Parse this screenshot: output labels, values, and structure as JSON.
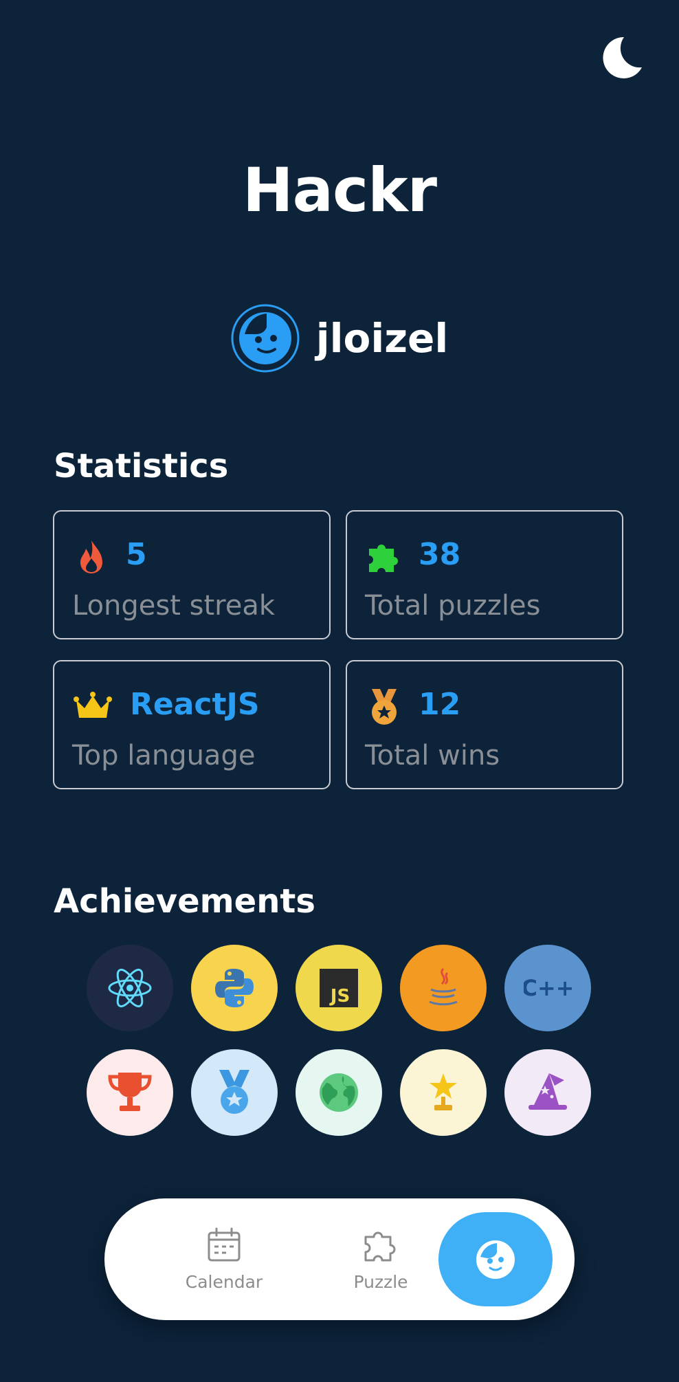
{
  "app": {
    "title": "Hackr"
  },
  "profile": {
    "username": "jloizel"
  },
  "statistics": {
    "title": "Statistics",
    "cards": [
      {
        "icon": "flame-icon",
        "value": "5",
        "label": "Longest streak"
      },
      {
        "icon": "puzzle-piece-icon",
        "value": "38",
        "label": "Total puzzles"
      },
      {
        "icon": "crown-icon",
        "value": "ReactJS",
        "label": "Top language"
      },
      {
        "icon": "medal-icon",
        "value": "12",
        "label": "Total wins"
      }
    ]
  },
  "achievements": {
    "title": "Achievements",
    "badges": [
      {
        "icon": "react-icon",
        "bg": "#1e2a45"
      },
      {
        "icon": "python-icon",
        "bg": "#f7d34e"
      },
      {
        "icon": "javascript-icon",
        "bg": "#efd84c"
      },
      {
        "icon": "java-icon",
        "bg": "#f39a23"
      },
      {
        "icon": "cplusplus-icon",
        "bg": "#5b93cf"
      },
      {
        "icon": "trophy-icon",
        "bg": "#fdeaea"
      },
      {
        "icon": "medal-badge-icon",
        "bg": "#d3e8f8"
      },
      {
        "icon": "globe-icon",
        "bg": "#e6f6f0"
      },
      {
        "icon": "star-award-icon",
        "bg": "#fbf5d6"
      },
      {
        "icon": "wizard-hat-icon",
        "bg": "#f3eaf8"
      }
    ]
  },
  "nav": {
    "items": [
      {
        "label": "Calendar",
        "icon": "calendar-icon"
      },
      {
        "label": "Puzzle",
        "icon": "puzzle-icon"
      },
      {
        "label": "",
        "icon": "profile-face-icon",
        "active": true
      }
    ]
  },
  "colors": {
    "background": "#0c233a",
    "accent": "#2a9df4",
    "nav_active": "#3fb0f6",
    "card_border": "#c8ccd2",
    "muted_text": "#8a8f96"
  }
}
